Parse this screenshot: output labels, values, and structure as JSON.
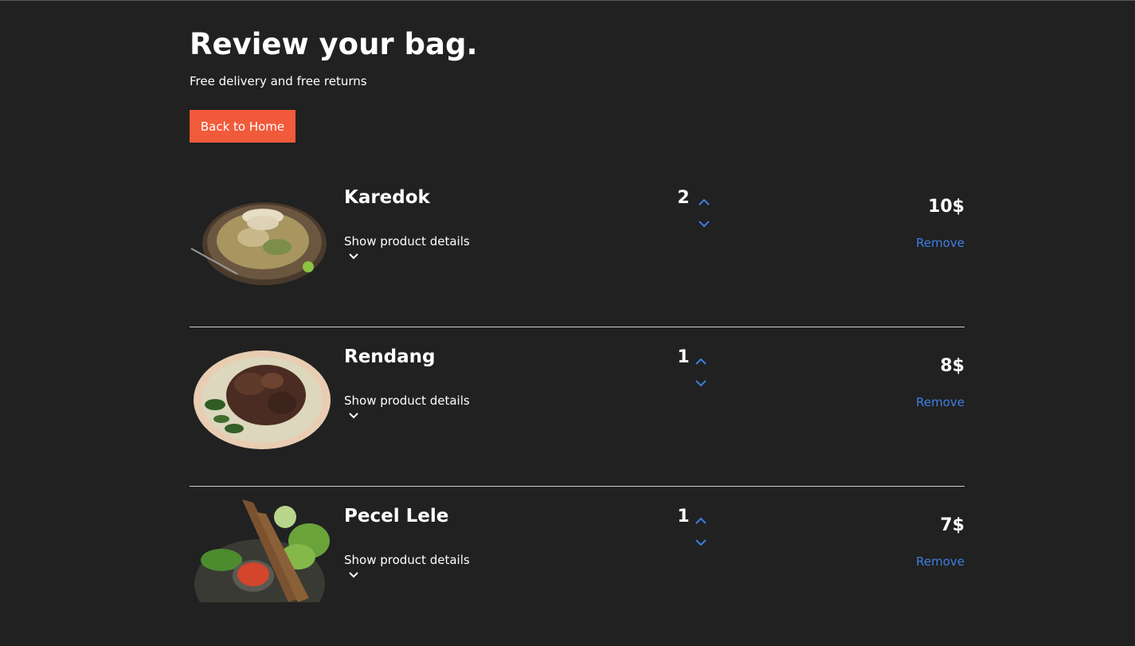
{
  "header": {
    "title": "Review your bag.",
    "subtitle": "Free delivery and free returns",
    "back_button": "Back to Home"
  },
  "items": [
    {
      "name": "Karedok",
      "details_label": "Show product details",
      "quantity": "2",
      "price": "10$",
      "remove_label": "Remove",
      "image": "karedok-food-photo"
    },
    {
      "name": "Rendang",
      "details_label": "Show product details",
      "quantity": "1",
      "price": "8$",
      "remove_label": "Remove",
      "image": "rendang-food-photo"
    },
    {
      "name": "Pecel Lele",
      "details_label": "Show product details",
      "quantity": "1",
      "price": "7$",
      "remove_label": "Remove",
      "image": "pecel-lele-food-photo"
    }
  ],
  "colors": {
    "background": "#212121",
    "accent_button": "#f15a3b",
    "link": "#3d7ee6",
    "text": "#ffffff"
  },
  "icons": {
    "quantity_up": "chevron-up-icon",
    "quantity_down": "chevron-down-icon",
    "details_toggle": "chevron-down-icon"
  }
}
